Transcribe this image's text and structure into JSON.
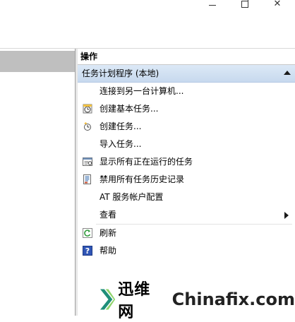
{
  "window": {
    "minimize": "—",
    "maximize": "□",
    "close": "✕"
  },
  "actions": {
    "header": "操作",
    "group": {
      "label": "任务计划程序 (本地)"
    },
    "items": [
      {
        "label": "连接到另一台计算机...",
        "icon": ""
      },
      {
        "label": "创建基本任务...",
        "icon": "create-basic-task-icon"
      },
      {
        "label": "创建任务...",
        "icon": "create-task-icon"
      },
      {
        "label": "导入任务...",
        "icon": ""
      },
      {
        "label": "显示所有正在运行的任务",
        "icon": "running-tasks-icon"
      },
      {
        "label": "禁用所有任务历史记录",
        "icon": "task-history-icon"
      },
      {
        "label": "AT 服务帐户配置",
        "icon": ""
      },
      {
        "label": "查看",
        "icon": "",
        "submenu": true
      },
      {
        "label": "刷新",
        "icon": "refresh-icon"
      },
      {
        "label": "帮助",
        "icon": "help-icon"
      }
    ]
  },
  "watermark": {
    "brand": "迅维网",
    "site": "Chinafix.com"
  }
}
